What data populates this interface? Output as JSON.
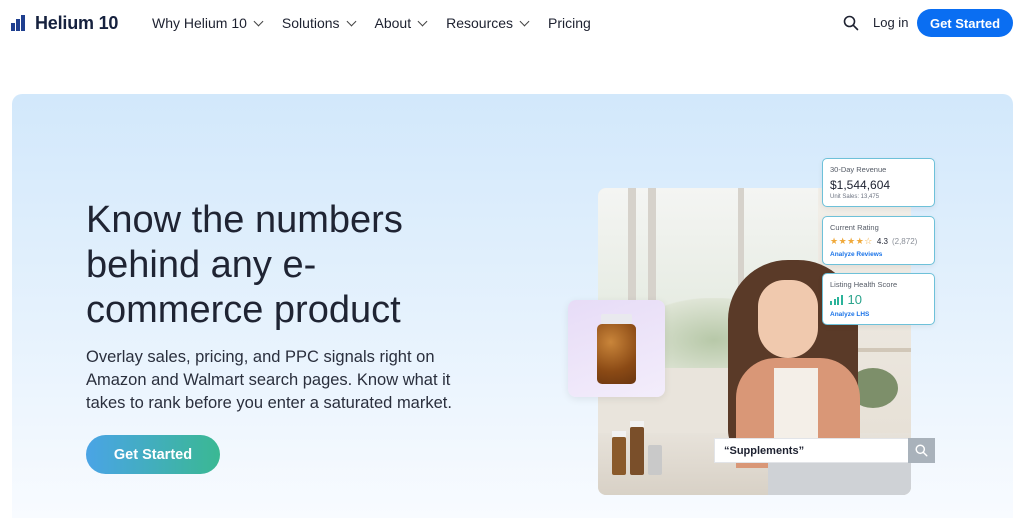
{
  "nav": {
    "logo_text": "Helium 10",
    "menu": [
      {
        "label": "Why Helium 10",
        "has_dropdown": true
      },
      {
        "label": "Solutions",
        "has_dropdown": true
      },
      {
        "label": "About",
        "has_dropdown": true
      },
      {
        "label": "Resources",
        "has_dropdown": true
      },
      {
        "label": "Pricing",
        "has_dropdown": false
      }
    ],
    "search_icon": "search-icon",
    "login_label": "Log in",
    "cta_label": "Get Started"
  },
  "hero": {
    "headline": "Know the numbers behind any e-commerce product",
    "subtext": "Overlay sales, pricing, and PPC signals right on Amazon and Walmart search pages. Know what it takes to rank before you enter a saturated market.",
    "cta_label": "Get Started"
  },
  "metrics": {
    "revenue": {
      "title": "30-Day Revenue",
      "value": "$1,544,604",
      "sub": "Unit Sales: 13,475"
    },
    "rating": {
      "title": "Current Rating",
      "stars": "★★★★☆",
      "value": "4.3",
      "count": "(2,872)",
      "link": "Analyze Reviews"
    },
    "health": {
      "title": "Listing Health Score",
      "value": "10",
      "link": "Analyze LHS"
    }
  },
  "search": {
    "query": "“Supplements”"
  },
  "colors": {
    "primary": "#0a6ef2",
    "gradient_start": "#4aa4e6",
    "gradient_end": "#3ab893",
    "accent_teal": "#2aa38c",
    "card_border": "#6ec1d9"
  }
}
